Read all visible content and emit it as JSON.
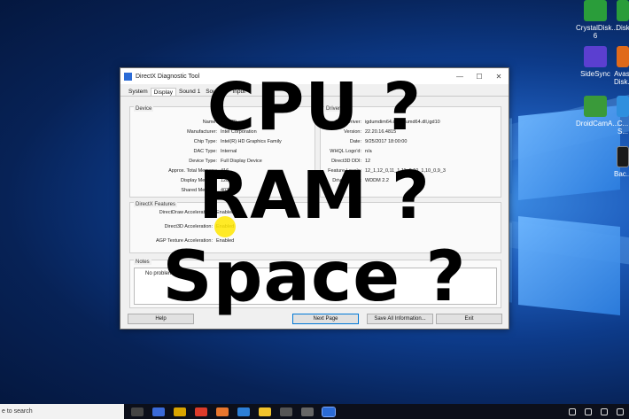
{
  "desktop_icons": [
    {
      "label": "CrystalDisk... 6",
      "color": "#2a9d3a"
    },
    {
      "label": "Disk",
      "color": "#2a9d3a"
    },
    {
      "label": "SideSync",
      "color": "#5b3fd0"
    },
    {
      "label": "Avast Disk...",
      "color": "#e06a1a"
    },
    {
      "label": "DroidCamA...",
      "color": "#3a9a3a"
    },
    {
      "label": "C... S...",
      "color": "#2f8fde"
    },
    {
      "label": "Bac...",
      "color": "#1a1a1a"
    }
  ],
  "window": {
    "title": "DirectX Diagnostic Tool",
    "controls": [
      "—",
      "☐",
      "✕"
    ],
    "tabs": [
      "System",
      "Display",
      "Sound 1",
      "Sound 2",
      "Input"
    ],
    "device_group_title": "Device",
    "device": [
      {
        "label": "Name:",
        "value": "Intel(R)"
      },
      {
        "label": "Manufacturer:",
        "value": "Intel Corporation"
      },
      {
        "label": "Chip Type:",
        "value": "Intel(R) HD Graphics Family"
      },
      {
        "label": "DAC Type:",
        "value": "Internal"
      },
      {
        "label": "Device Type:",
        "value": "Full Display Device"
      },
      {
        "label": "Approx. Total Memory:",
        "value": "416"
      },
      {
        "label": "Display Memory:",
        "value": "128"
      },
      {
        "label": "Shared Memory:",
        "value": "403"
      }
    ],
    "drivers_group_title": "Drivers",
    "drivers": [
      {
        "label": "Main Driver:",
        "value": "igdumdim64.dll,igdumd64.dll,igd10"
      },
      {
        "label": "Version:",
        "value": "22.20.16.4815"
      },
      {
        "label": "Date:",
        "value": "9/25/2017 18:00:00"
      },
      {
        "label": "WHQL Logo'd:",
        "value": "n/a"
      },
      {
        "label": "Direct3D DDI:",
        "value": "12"
      },
      {
        "label": "Feature Levels:",
        "value": "12_1,12_0,11_1,11_0,10_1,10_0,9_3"
      },
      {
        "label": "Driver Model:",
        "value": "WDDM 2.2"
      }
    ],
    "features_group_title": "DirectX Features",
    "features": [
      {
        "label": "DirectDraw Acceleration:",
        "value": "Enabled"
      },
      {
        "label": "Direct3D Acceleration:",
        "value": "Enabled"
      },
      {
        "label": "AGP Texture Acceleration:",
        "value": "Enabled"
      }
    ],
    "notes_group_title": "Notes",
    "notes_text": "No problems found.",
    "buttons": {
      "help": "Help",
      "next_page": "Next Page",
      "save_all": "Save All Information...",
      "exit": "Exit"
    }
  },
  "overlay": {
    "line1": "CPU ?",
    "line2": "RAM ?",
    "line3": "Space ?"
  },
  "taskbar": {
    "search_placeholder": "e to search"
  }
}
